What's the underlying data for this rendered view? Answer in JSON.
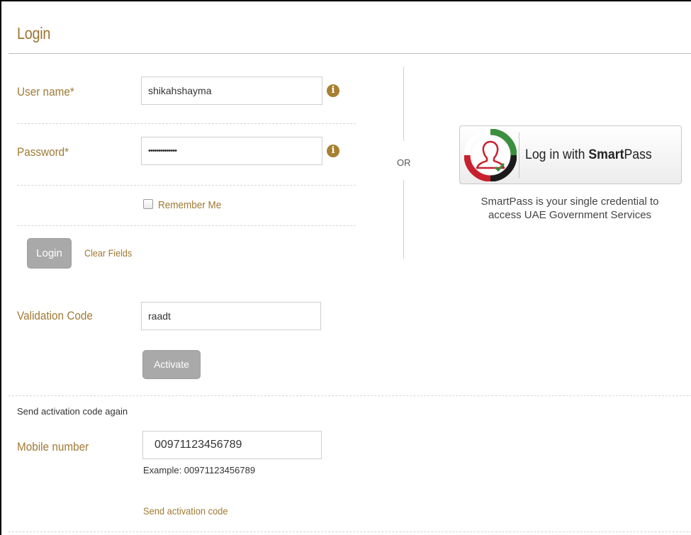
{
  "login_form": {
    "title": "Login",
    "username": {
      "label": "User name*",
      "value": "shikahshayma"
    },
    "password": {
      "label": "Password*",
      "value": "••••••••••••••"
    },
    "info_icon_glyph": "i",
    "remember_me_label": "Remember Me",
    "login_button": "Login",
    "clear_fields_link": "Clear Fields"
  },
  "separator": {
    "or_text": "OR"
  },
  "smartpass": {
    "button_prefix": "Log in with ",
    "button_brand_bold": "Smart",
    "button_brand_rest": "Pass",
    "description_line1": "SmartPass is your single credential to",
    "description_line2": "access UAE Government Services",
    "icon": "smartpass-logo-icon"
  },
  "validation": {
    "label": "Validation Code",
    "value": "raadt",
    "activate_button": "Activate"
  },
  "resend": {
    "heading": "Send activation code again",
    "mobile_label": "Mobile number",
    "mobile_value": "00971123456789",
    "example_text": "Example: 00971123456789",
    "send_link": "Send activation code"
  },
  "colors": {
    "accent_gold": "#a07a35",
    "button_gray": "#a9a9a9"
  }
}
